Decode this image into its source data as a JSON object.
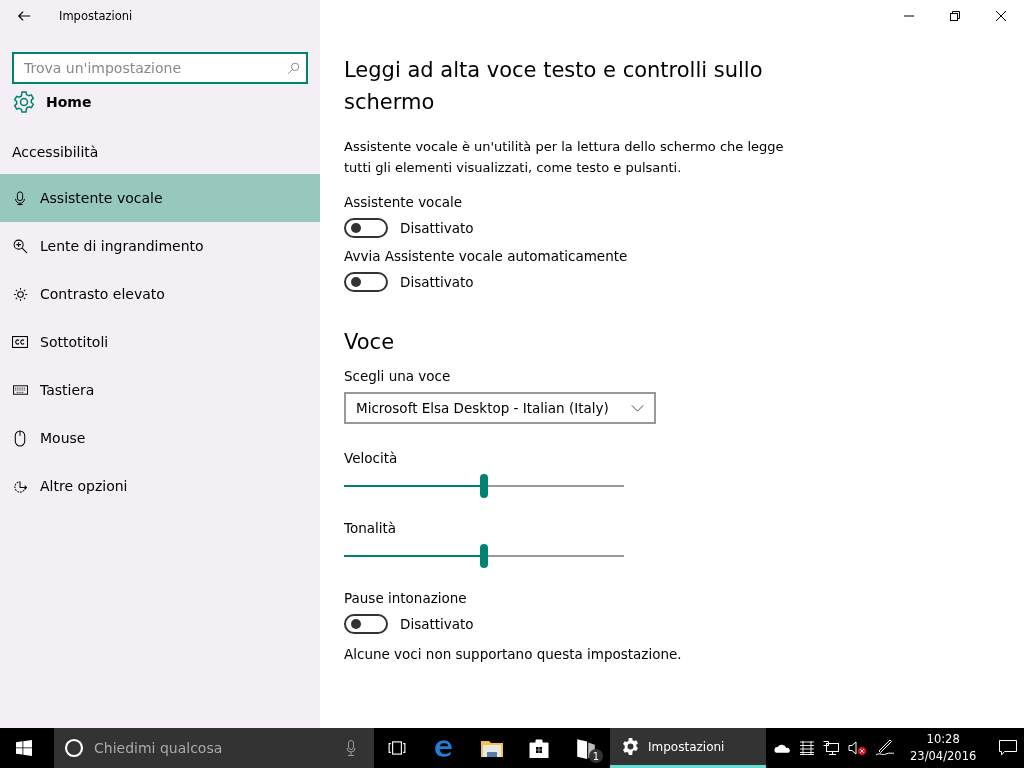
{
  "window": {
    "title": "Impostazioni"
  },
  "sidebar": {
    "search": {
      "placeholder": "Trova un'impostazione"
    },
    "home": "Home",
    "section": "Accessibilità",
    "items": [
      {
        "label": "Assistente vocale",
        "selected": true
      },
      {
        "label": "Lente di ingrandimento",
        "selected": false
      },
      {
        "label": "Contrasto elevato",
        "selected": false
      },
      {
        "label": "Sottotitoli",
        "selected": false
      },
      {
        "label": "Tastiera",
        "selected": false
      },
      {
        "label": "Mouse",
        "selected": false
      },
      {
        "label": "Altre opzioni",
        "selected": false
      }
    ]
  },
  "content": {
    "title": "Leggi ad alta voce testo e controlli sullo schermo",
    "description": "Assistente vocale è un'utilità per la lettura dello schermo che legge tutti gli elementi visualizzati, come testo e pulsanti.",
    "settings": [
      {
        "kind": "toggle",
        "label": "Assistente vocale",
        "on": false,
        "state": "Disattivato"
      },
      {
        "kind": "toggle",
        "label": "Avvia Assistente vocale automaticamente",
        "on": false,
        "state": "Disattivato"
      },
      {
        "kind": "heading",
        "label": "Voce"
      },
      {
        "kind": "dropdown",
        "label": "Scegli una voce",
        "value": "Microsoft Elsa Desktop - Italian (Italy)"
      },
      {
        "kind": "slider",
        "label": "Velocità",
        "level": 0.5
      },
      {
        "kind": "slider",
        "label": "Tonalità",
        "level": 0.5
      },
      {
        "kind": "toggle",
        "label": "Pause intonazione",
        "on": false,
        "state": "Disattivato"
      },
      {
        "kind": "note",
        "label": "Alcune voci non supportano questa impostazione."
      }
    ]
  },
  "taskbar": {
    "search": {
      "placeholder": "Chiedimi qualcosa"
    },
    "badge": "1",
    "active_app": {
      "label": "Impostazioni",
      "selected": true
    },
    "time": "10:28",
    "date": "23/04/2016"
  }
}
